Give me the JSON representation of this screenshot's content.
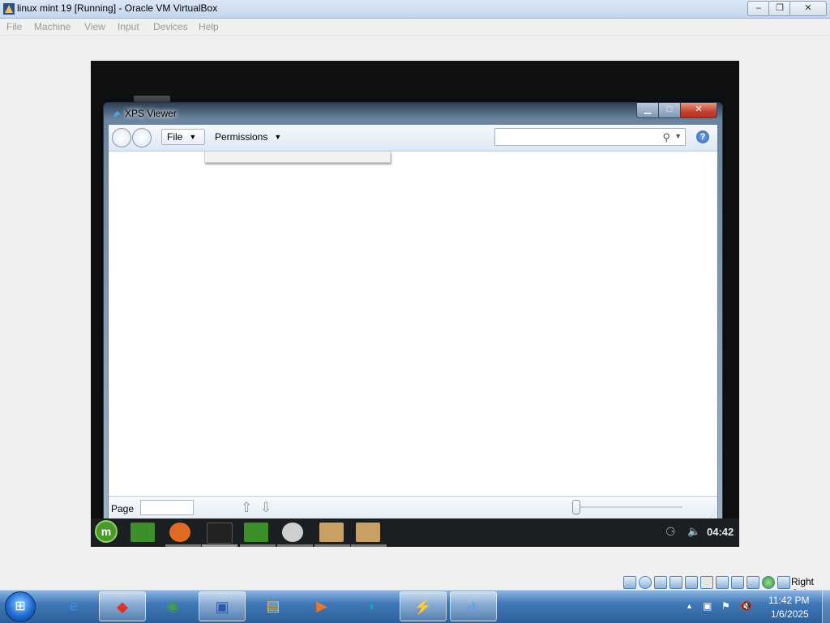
{
  "host_window": {
    "title": "linux mint 19 [Running] - Oracle VM VirtualBox",
    "controls": {
      "minimize": "–",
      "restore": "❐",
      "close": "✕"
    },
    "menu": [
      "File",
      "Machine",
      "View",
      "Input",
      "Devices",
      "Help"
    ]
  },
  "xps_viewer": {
    "title": "XPS Viewer",
    "controls": {
      "minimize": "▁",
      "maximize": "□",
      "close": "✕"
    },
    "toolbar": {
      "file_label": "File",
      "permissions_label": "Permissions",
      "search_placeholder": "",
      "help_glyph": "?"
    },
    "status_bar": {
      "page_label": "Page",
      "page_value": "",
      "up_glyph": "⇧",
      "down_glyph": "⇩"
    }
  },
  "mint_panel": {
    "clock": "04:42",
    "menu_glyph": "m",
    "apps": [
      {
        "name": "files-green",
        "color": "#3d8f2a"
      },
      {
        "name": "firefox",
        "color": "#e06b24"
      },
      {
        "name": "terminal",
        "color": "#222222"
      },
      {
        "name": "files-green-2",
        "color": "#3d8f2a"
      },
      {
        "name": "disc",
        "color": "#cfcfcf"
      },
      {
        "name": "folder-tan",
        "color": "#c8a064"
      },
      {
        "name": "folder-tan-2",
        "color": "#c8a064"
      }
    ]
  },
  "vb_status": {
    "host_key": "Right Ctrl"
  },
  "taskbar": {
    "start_glyph": "⊞",
    "items": [
      {
        "name": "internet-explorer",
        "glyph": "e",
        "color": "#3c8de0"
      },
      {
        "name": "app-red",
        "glyph": "◆",
        "color": "#d9342b"
      },
      {
        "name": "app-globe",
        "glyph": "◉",
        "color": "#3aa34a"
      },
      {
        "name": "virtualbox",
        "glyph": "▣",
        "color": "#2a5aa8"
      },
      {
        "name": "explorer",
        "glyph": "▤",
        "color": "#e8c15a"
      },
      {
        "name": "media",
        "glyph": "▶",
        "color": "#e8772e"
      },
      {
        "name": "app-teal",
        "glyph": "◐",
        "color": "#1aa7a0"
      },
      {
        "name": "app-64",
        "glyph": "⚡",
        "color": "#f0b020"
      },
      {
        "name": "vm-active",
        "glyph": "✈",
        "color": "#5ea0e0"
      }
    ],
    "clock_time": "11:42 PM",
    "clock_date": "1/6/2025"
  }
}
